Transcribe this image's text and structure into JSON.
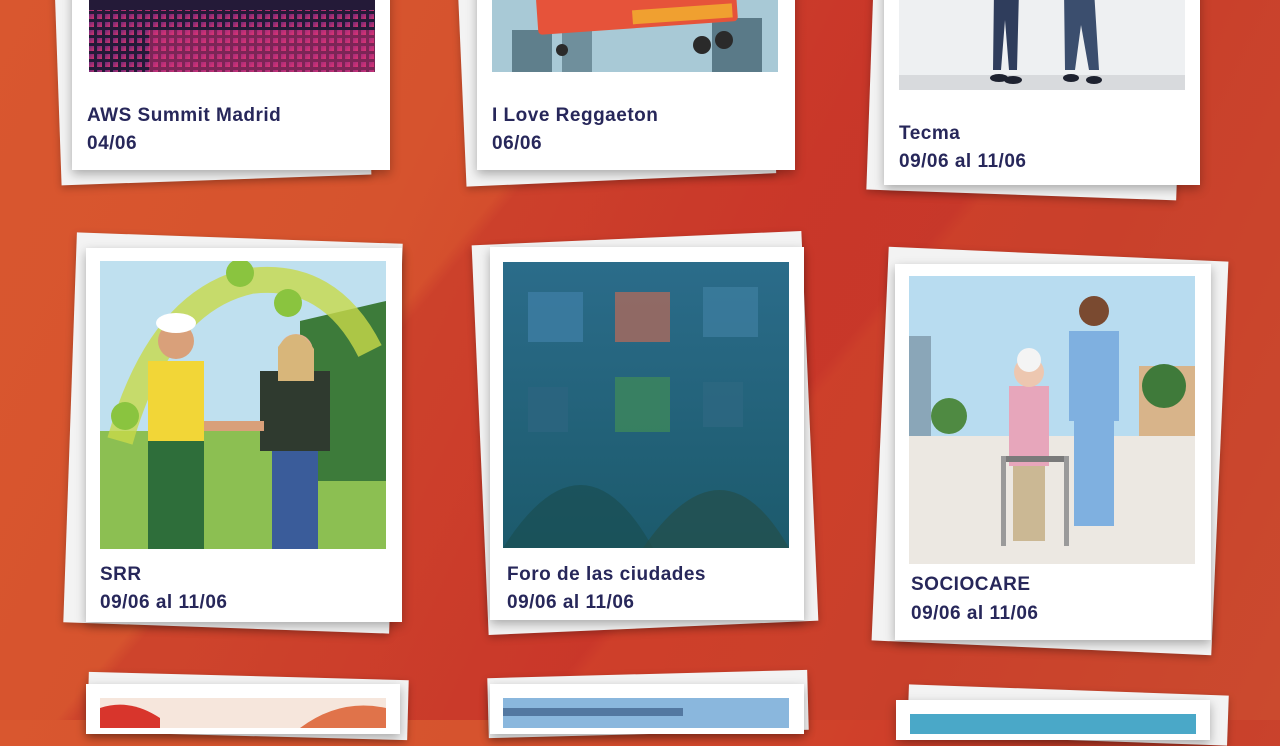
{
  "events": [
    {
      "title": "AWS Summit Madrid",
      "date": "04/06",
      "image": "aws-pixel-art"
    },
    {
      "title": "I Love Reggaeton",
      "date": "06/06",
      "image": "reggaeton-poster"
    },
    {
      "title": "Tecma",
      "date": "09/06 al 11/06",
      "image": "people-walking"
    },
    {
      "title": "SRR",
      "date": "09/06 al 11/06",
      "image": "handshake-recycling"
    },
    {
      "title": "Foro de las ciudades",
      "date": "09/06 al 11/06",
      "image": "cubes-grass"
    },
    {
      "title": "SOCIOCARE",
      "date": "09/06 al 11/06",
      "image": "nurse-elderly-walker"
    }
  ],
  "colors": {
    "background": "#d6532e",
    "text": "#27275a",
    "card": "#ffffff"
  }
}
